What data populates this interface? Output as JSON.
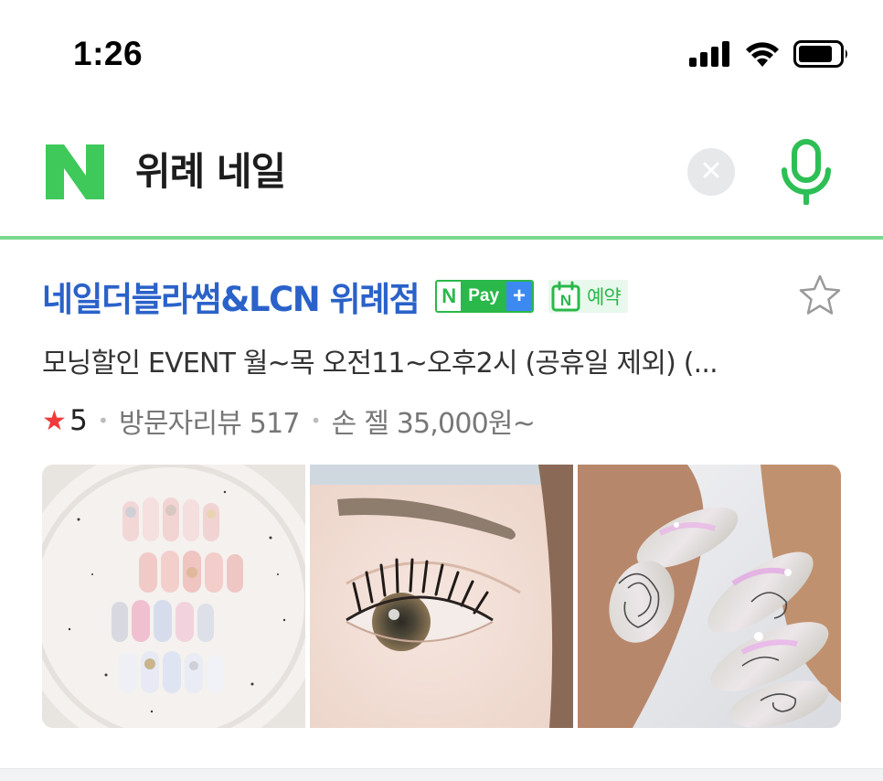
{
  "status_bar": {
    "time": "1:26",
    "icons": [
      "cellular-signal-icon",
      "wifi-icon",
      "battery-icon"
    ]
  },
  "search": {
    "logo_letter": "N",
    "query": "위례 네일",
    "clear_icon": "close-icon",
    "voice_icon": "microphone-icon"
  },
  "result": {
    "title": "네일더블라썸&LCN 위례점",
    "npay_badge": {
      "n": "N",
      "pay": "Pay",
      "plus": "+"
    },
    "reserve_badge": {
      "n": "N",
      "label": "예약"
    },
    "description": "모닝할인 EVENT 월~목 오전11~오후2시 (공휴일 제외) (...",
    "rating_star": "★",
    "rating": "5",
    "review_text": "방문자리뷰 517",
    "price_text": "손 젤 35,000원~",
    "photos": [
      {
        "subject": "nail-tips-on-plate-photo"
      },
      {
        "subject": "eyelash-lift-photo"
      },
      {
        "subject": "nail-art-hand-photo"
      }
    ]
  },
  "colors": {
    "naver_green": "#03c75a",
    "title_blue": "#2a62c9",
    "rating_red": "#ef3b3b",
    "npay_green": "#2ab84a",
    "npay_blue": "#3c8af1"
  }
}
